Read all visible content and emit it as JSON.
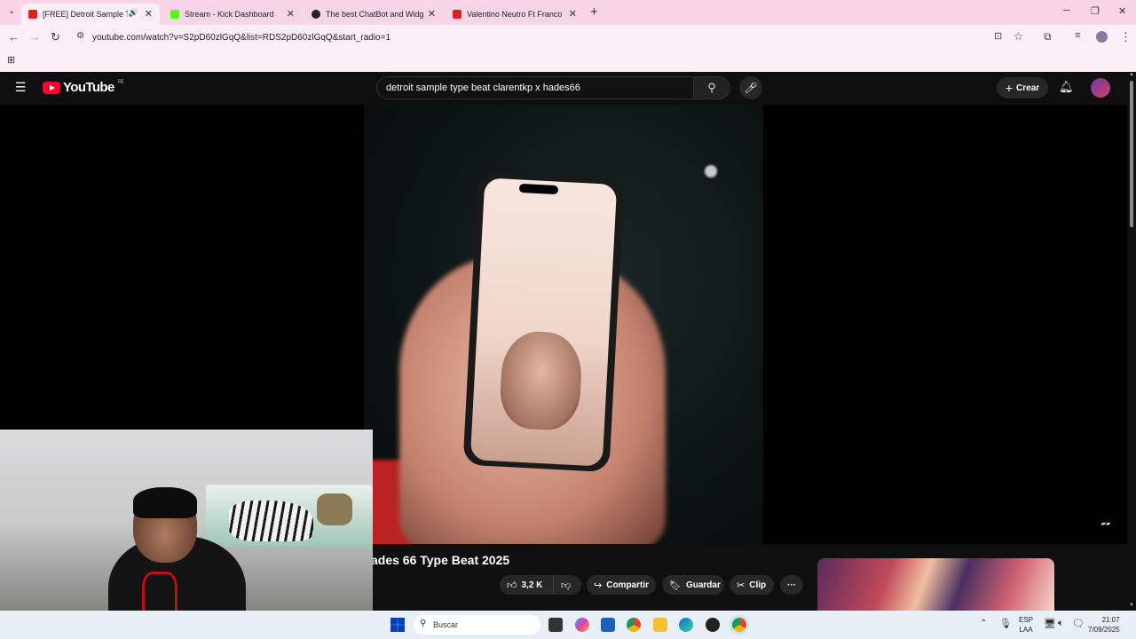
{
  "browser": {
    "tabs": [
      {
        "title": "[FREE] Detroit Sample Type",
        "favicon_color": "#e02020",
        "active": true,
        "audio_icon": "speaker-icon"
      },
      {
        "title": "Stream - Kick Dashboard",
        "favicon_color": "#53fc18",
        "active": false
      },
      {
        "title": "The best ChatBot and Widgets",
        "favicon_color": "#222222",
        "active": false
      },
      {
        "title": "Valentino Neutro Ft Franco Dar",
        "favicon_color": "#e02020",
        "active": false
      }
    ],
    "new_tab_symbol": "+",
    "url": "youtube.com/watch?v=S2pD60zlGqQ&list=RDS2pD60zlGqQ&start_radio=1"
  },
  "youtube": {
    "logo_text": "YouTube",
    "country_code": "PE",
    "search_query": "detroit  sample type beat clarentkp x hades66",
    "create_label": "Crear",
    "video": {
      "title": "ades 66 Type Beat 2025",
      "likes": "3,2 K",
      "share_label": "Compartir",
      "save_label": "Guardar",
      "clip_label": "Clip",
      "more_symbol": "···"
    }
  },
  "taskbar": {
    "search_placeholder": "Buscar",
    "lang_line1": "ESP",
    "lang_line2": "LAA",
    "time": "21:07",
    "date": "7/09/2025"
  },
  "colors": {
    "youtube_red": "#ff0033",
    "browser_accent": "#f7d5e6",
    "yt_background": "#0f0f0f"
  }
}
